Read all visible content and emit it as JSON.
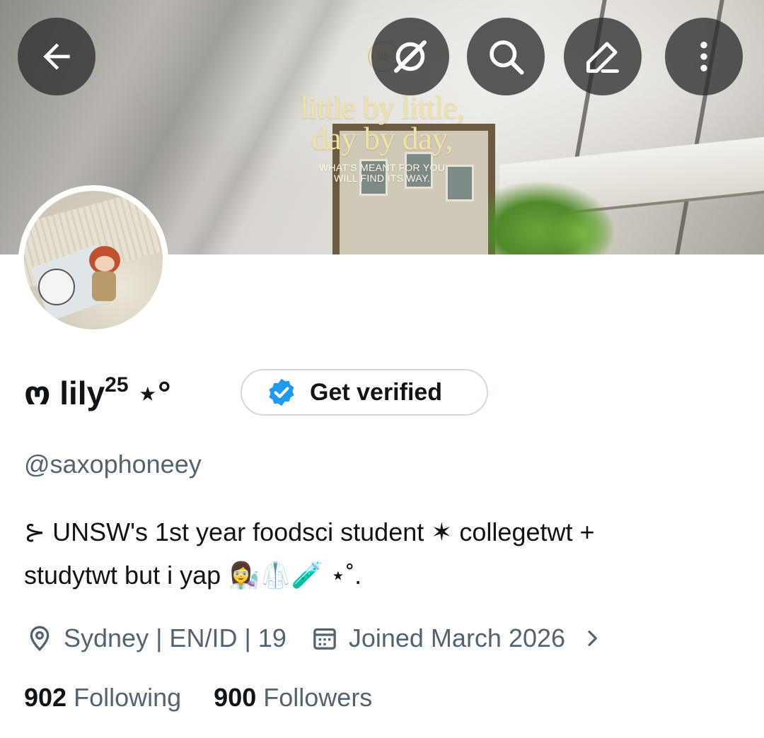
{
  "banner": {
    "quote_line1": "little by little,",
    "quote_line2": "day by day,",
    "quote_line3": "WHAT'S MEANT FOR YOU",
    "quote_line4": "WILL FIND ITS WAY.",
    "badge_number": "09"
  },
  "toolbar": {
    "back_icon": "arrow-left-icon",
    "grok_icon": "grok-icon",
    "search_icon": "search-icon",
    "edit_icon": "pencil-icon",
    "more_icon": "more-vertical-icon"
  },
  "profile": {
    "name_prefix": "ო lily",
    "name_sup": "25",
    "name_suffix": " ⋆°",
    "verify_label": "Get verified",
    "handle": "@saxophoneey",
    "bio_line1": "⊱ UNSW's 1st year foodsci student ✶ collegetwt +",
    "bio_line2": "studytwt but i yap 👩‍🔬🥼🧪 ⋆˚.",
    "location": "Sydney | EN/ID | 19",
    "joined": "Joined March 2026",
    "following_count": "902",
    "following_label": "Following",
    "followers_count": "900",
    "followers_label": "Followers"
  },
  "colors": {
    "primary_text": "#0f1419",
    "secondary_text": "#536471",
    "verify_blue": "#1d9bf0",
    "button_border": "#cfd9de"
  }
}
